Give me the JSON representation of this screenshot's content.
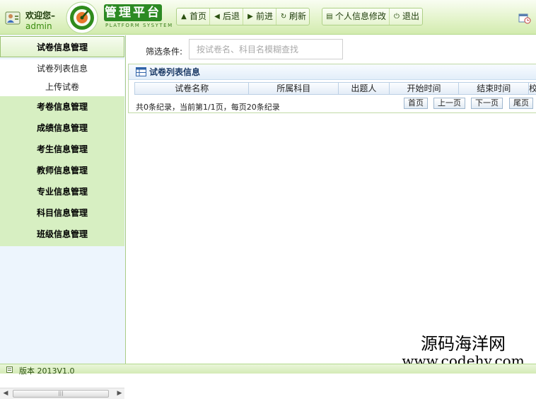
{
  "header": {
    "welcome": "欢迎您–",
    "username": "admin",
    "logo_title": "管理平台",
    "logo_sub": "PLATFORM SYSYTEM",
    "nav": [
      {
        "label": "首页",
        "icon": "home-icon"
      },
      {
        "label": "后退",
        "icon": "back-icon"
      },
      {
        "label": "前进",
        "icon": "forward-icon"
      },
      {
        "label": "刷新",
        "icon": "refresh-icon"
      }
    ],
    "profile_label": "个人信息修改",
    "logout_label": "退出"
  },
  "sidebar": {
    "sections": [
      {
        "label": "试卷信息管理",
        "expanded": true,
        "items": [
          "试卷列表信息",
          "上传试卷"
        ]
      },
      {
        "label": "考卷信息管理"
      },
      {
        "label": "成绩信息管理"
      },
      {
        "label": "考生信息管理"
      },
      {
        "label": "教师信息管理"
      },
      {
        "label": "专业信息管理"
      },
      {
        "label": "科目信息管理"
      },
      {
        "label": "班级信息管理"
      }
    ]
  },
  "main": {
    "filter_label": "筛选条件:",
    "filter_placeholder": "按试卷名、科目名模糊查找",
    "panel_title": "试卷列表信息",
    "columns": [
      "试卷名称",
      "所属科目",
      "出题人",
      "开始时间",
      "结束时间",
      "校"
    ],
    "pager_text": "共0条纪录，当前第1/1页，每页20条纪录",
    "pager_buttons": [
      "首页",
      "上一页",
      "下一页",
      "尾页"
    ]
  },
  "watermark": {
    "cn": "源码海洋网",
    "en": "www.codehy.com"
  },
  "footer": {
    "version": "版本 2013V1.0"
  },
  "colors": {
    "header_green": "#d2ebae",
    "menu_green": "#d7efc2",
    "sidebar_blue": "#edf5fd",
    "logo_green": "#2c8a23"
  }
}
